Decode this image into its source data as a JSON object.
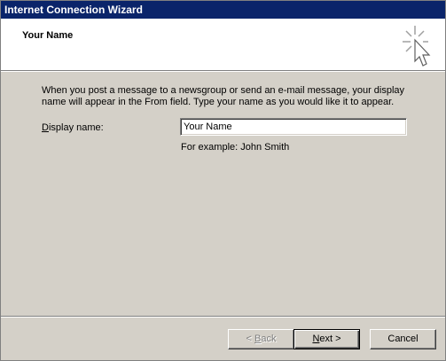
{
  "window": {
    "title": "Internet Connection Wizard"
  },
  "header": {
    "title": "Your Name",
    "icon": "wizard-sparkle-cursor-icon"
  },
  "body": {
    "description": "When you post a message to a newsgroup or send an e-mail message, your display name will appear in the From field.  Type your name as you would like it to appear.",
    "display_name_label_accel": "D",
    "display_name_label_rest": "isplay name:",
    "display_name_value": "Your Name",
    "example": "For example: John Smith"
  },
  "buttons": {
    "back_prefix": "< ",
    "back_accel": "B",
    "back_rest": "ack",
    "next_accel": "N",
    "next_rest": "ext >",
    "cancel": "Cancel"
  },
  "colors": {
    "titlebar": "#0a246a",
    "face": "#d4d0c8",
    "disabled_text": "#808080"
  }
}
